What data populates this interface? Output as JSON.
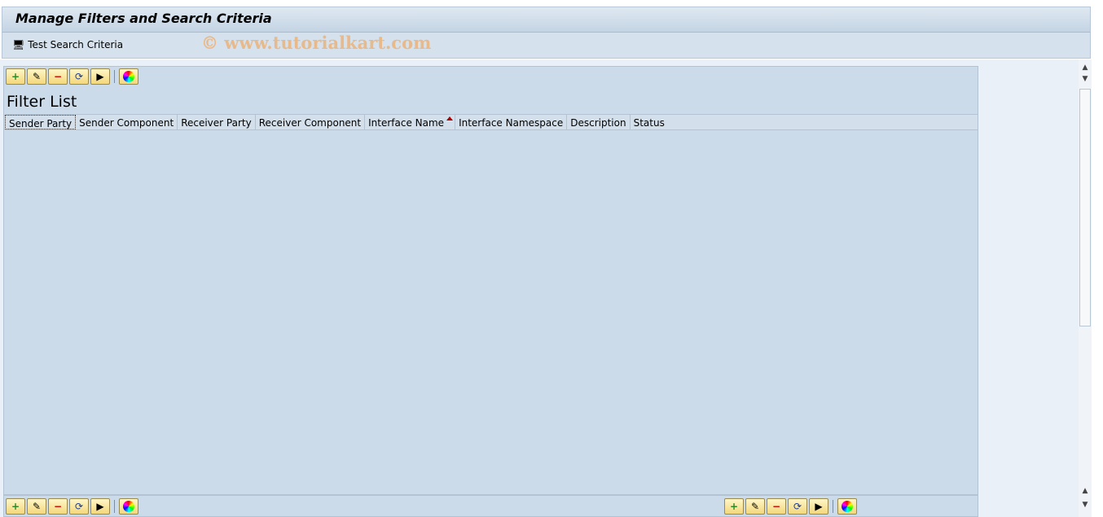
{
  "window": {
    "title": "Manage Filters and Search Criteria",
    "watermark": "© www.tutorialkart.com"
  },
  "appbar": {
    "test_search_label": "Test Search Criteria"
  },
  "panel": {
    "title": "Filter List",
    "columns": [
      "Sender Party",
      "Sender Component",
      "Receiver Party",
      "Receiver Component",
      "Interface Name",
      "Interface Namespace",
      "Description",
      "Status"
    ],
    "sorted_column": "Interface Name",
    "sort_direction": "ascending",
    "rows": []
  },
  "toolbar_icons": [
    "create-icon",
    "edit-icon",
    "delete-icon",
    "refresh-icon",
    "execute-icon",
    "colors-icon"
  ]
}
